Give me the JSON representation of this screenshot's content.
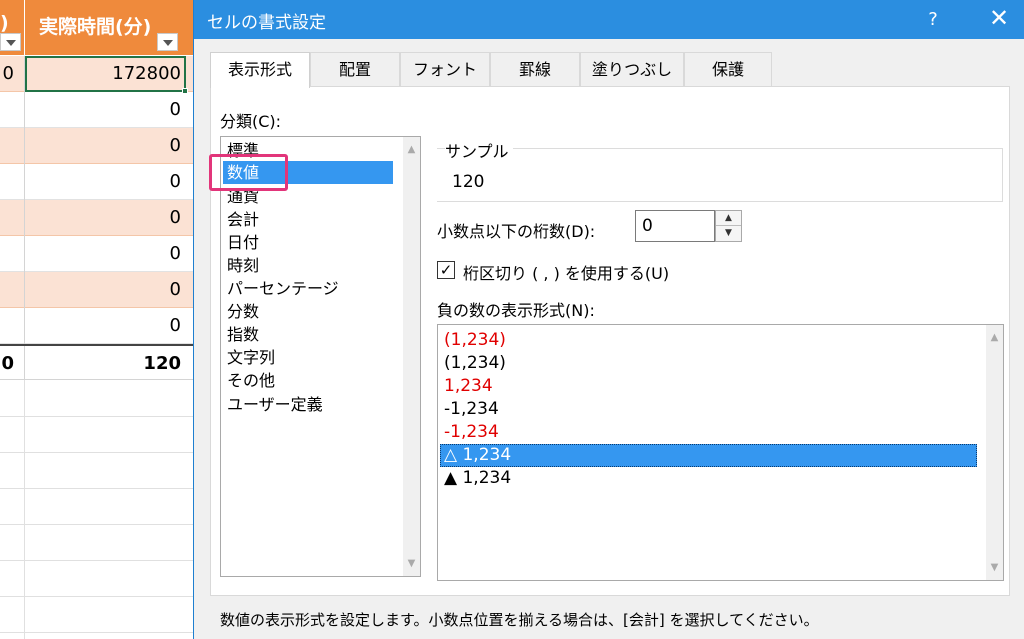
{
  "sheet": {
    "header_a": ")",
    "header_b": "実際時間(分)",
    "rows": [
      {
        "a": "0",
        "b": "172800"
      },
      {
        "a": "",
        "b": "0"
      },
      {
        "a": "",
        "b": "0"
      },
      {
        "a": "",
        "b": "0"
      },
      {
        "a": "",
        "b": "0"
      },
      {
        "a": "",
        "b": "0"
      },
      {
        "a": "",
        "b": "0"
      },
      {
        "a": "",
        "b": "0"
      }
    ],
    "total": {
      "a": "0",
      "b": "120"
    },
    "colors": {
      "header": "#ef8a3c",
      "band": "#fbe2d4",
      "selection": "#217346"
    }
  },
  "dialog": {
    "title": "セルの書式設定",
    "help": "?",
    "close": "✕",
    "tabs": [
      "表示形式",
      "配置",
      "フォント",
      "罫線",
      "塗りつぶし",
      "保護"
    ],
    "active_tab": "表示形式",
    "category_label": "分類(C):",
    "categories": [
      "標準",
      "数値",
      "通貨",
      "会計",
      "日付",
      "時刻",
      "パーセンテージ",
      "分数",
      "指数",
      "文字列",
      "その他",
      "ユーザー定義"
    ],
    "selected_category": "数値",
    "sample_label": "サンプル",
    "sample_value": "120",
    "decimals_label": "小数点以下の桁数(D):",
    "decimals_value": "0",
    "separator_label": "桁区切り ( , ) を使用する(U)",
    "separator_checked": true,
    "negative_label": "負の数の表示形式(N):",
    "negative_formats": [
      {
        "text": "(1,234)",
        "red": true
      },
      {
        "text": "(1,234)",
        "red": false
      },
      {
        "text": "1,234",
        "red": true
      },
      {
        "text": "-1,234",
        "red": false
      },
      {
        "text": "-1,234",
        "red": true
      },
      {
        "text": "△ 1,234",
        "red": false
      },
      {
        "text": "▲ 1,234",
        "red": false
      }
    ],
    "selected_negative": "△ 1,234",
    "description": "数値の表示形式を設定します。小数点位置を揃える場合は、[会計] を選択してください。",
    "colors": {
      "titlebar": "#2b8ee0",
      "selection": "#3597f0",
      "highlight": "#e2357a",
      "negative_red": "#e00000"
    }
  }
}
